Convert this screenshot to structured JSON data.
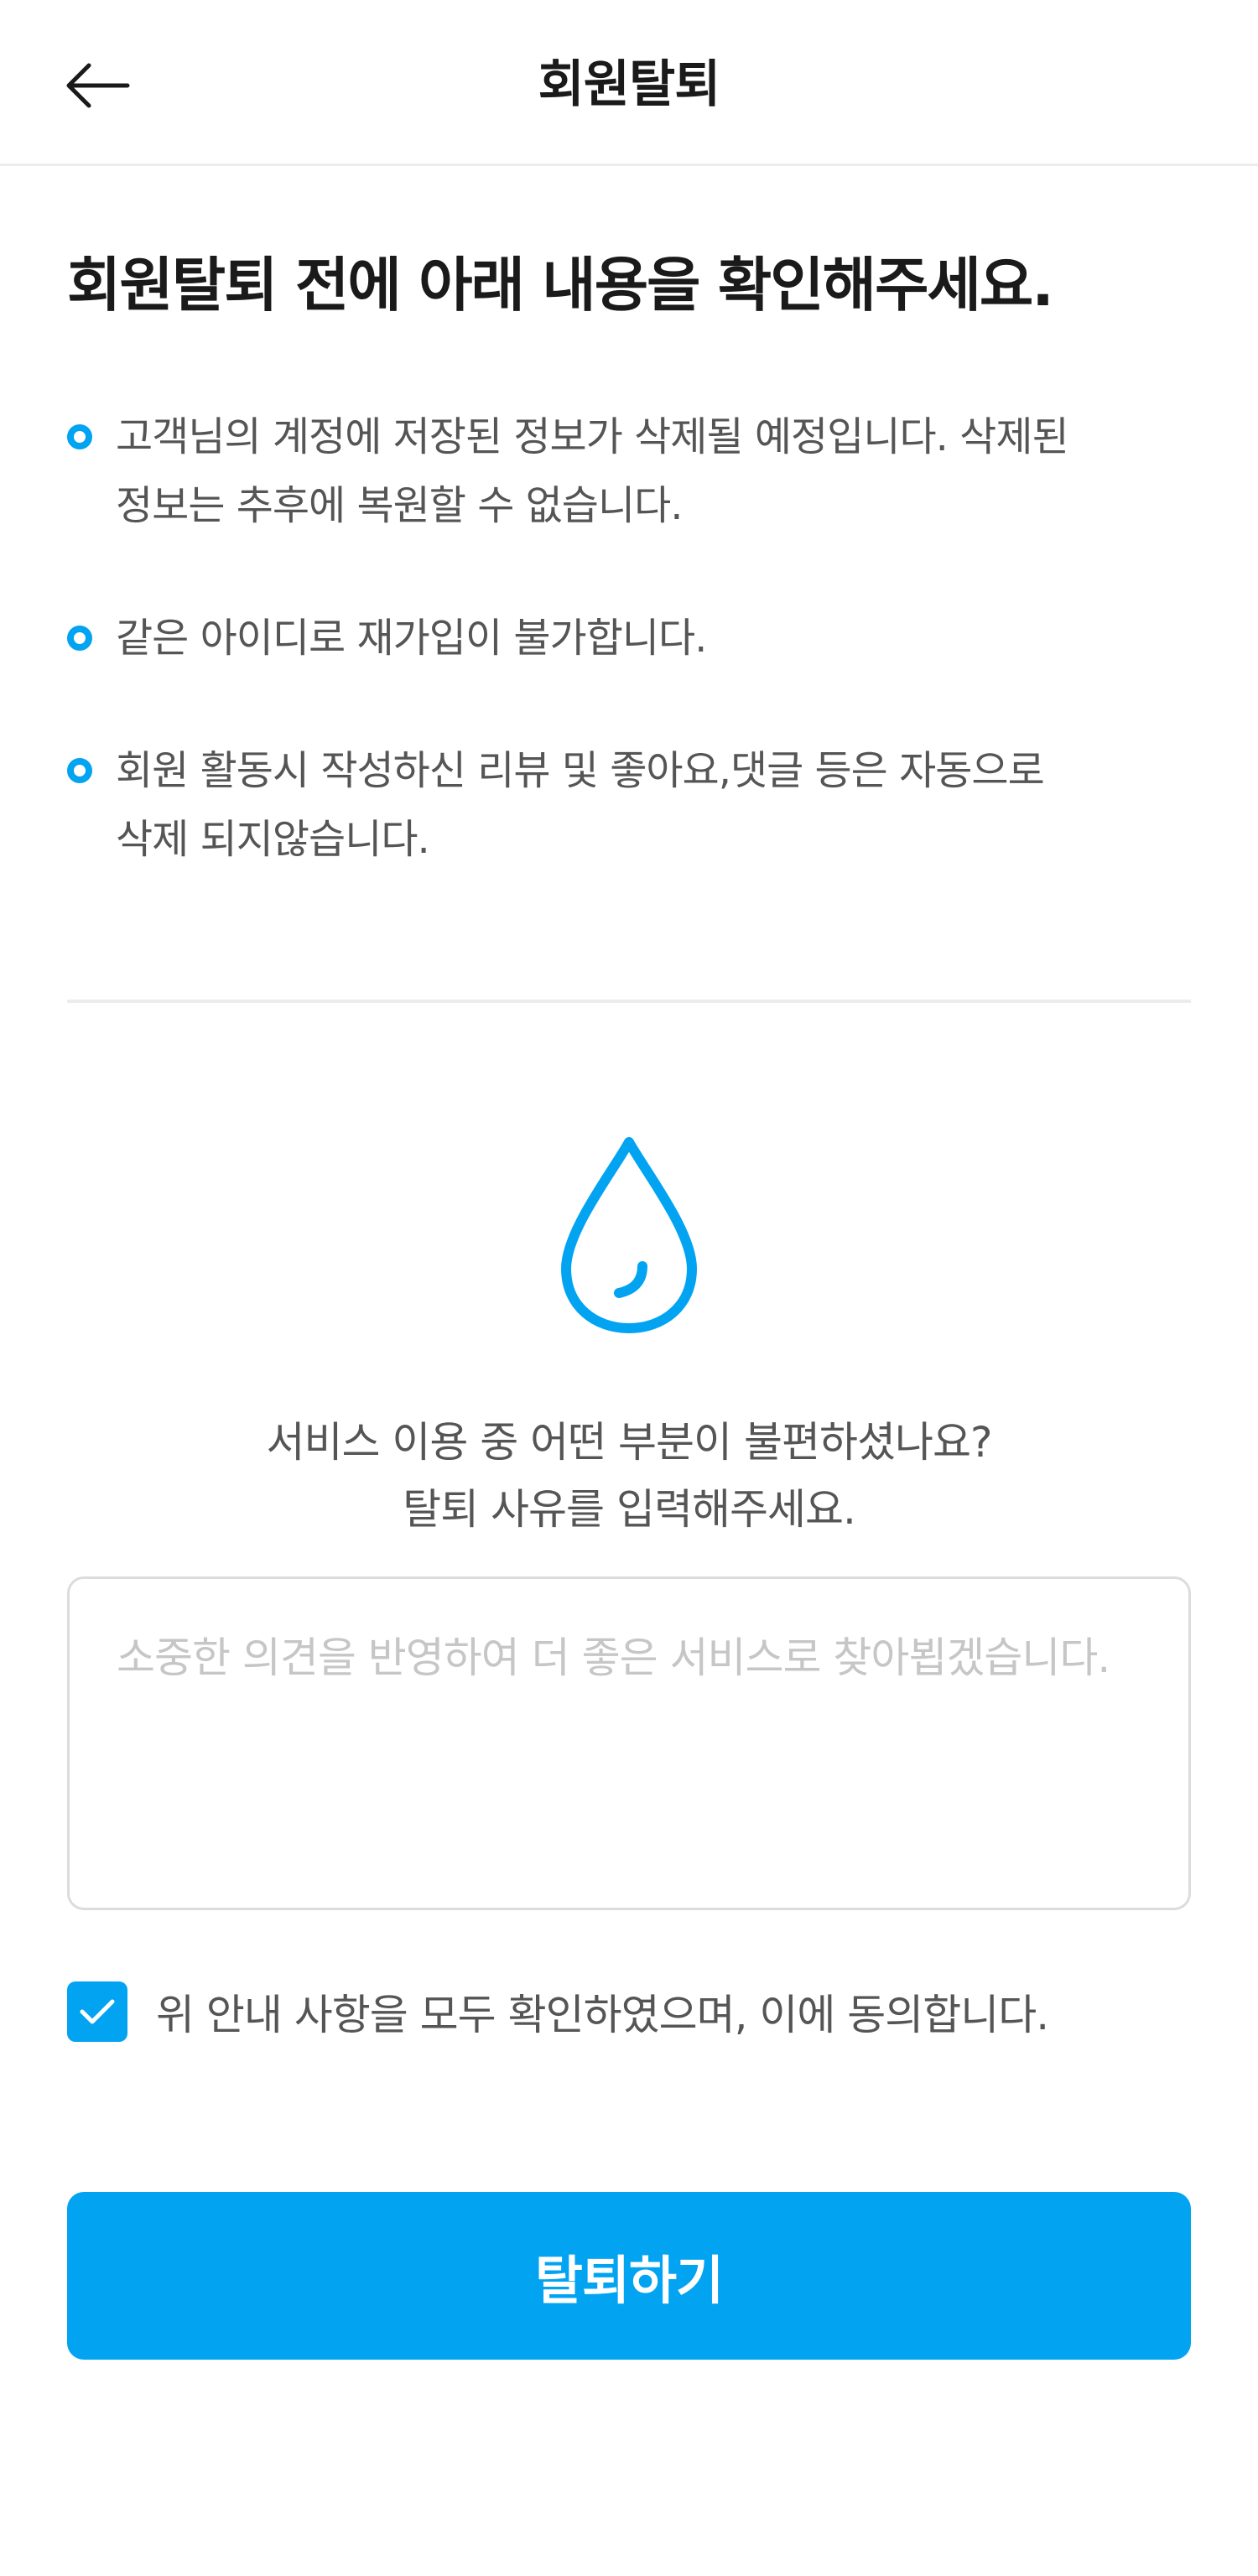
{
  "header": {
    "title": "회원탈퇴",
    "back_icon": "arrow-left-icon"
  },
  "main": {
    "headline": "회원탈퇴 전에 아래 내용을 확인해주세요.",
    "notices": [
      {
        "line1": "고객님의 계정에 저장된 정보가 삭제될 예정입니다. 삭제된",
        "line2": "정보는 추후에 복원할 수 없습니다."
      },
      {
        "line1": "같은 아이디로 재가입이 불가합니다.",
        "line2": ""
      },
      {
        "line1": "회원 활동시 작성하신 리뷰 및 좋아요,댓글 등은 자동으로",
        "line2": "삭제 되지않습니다."
      }
    ],
    "icon": "water-drop-icon",
    "question_line1": "서비스 이용 중 어떤 부분이 불편하셨나요?",
    "question_line2": "탈퇴 사유를 입력해주세요.",
    "reason_placeholder": "소중한 의견을 반영하여 더 좋은 서비스로 찾아뵙겠습니다.",
    "reason_value": "",
    "agree_label": "위 안내 사항을 모두 확인하였으며, 이에 동의합니다.",
    "agree_checked": true,
    "submit_label": "탈퇴하기"
  },
  "colors": {
    "accent": "#02A4F2",
    "text_primary": "#1A1A1A",
    "text_secondary": "#555555",
    "placeholder": "#C6C6C6",
    "divider": "#ECECEC"
  }
}
